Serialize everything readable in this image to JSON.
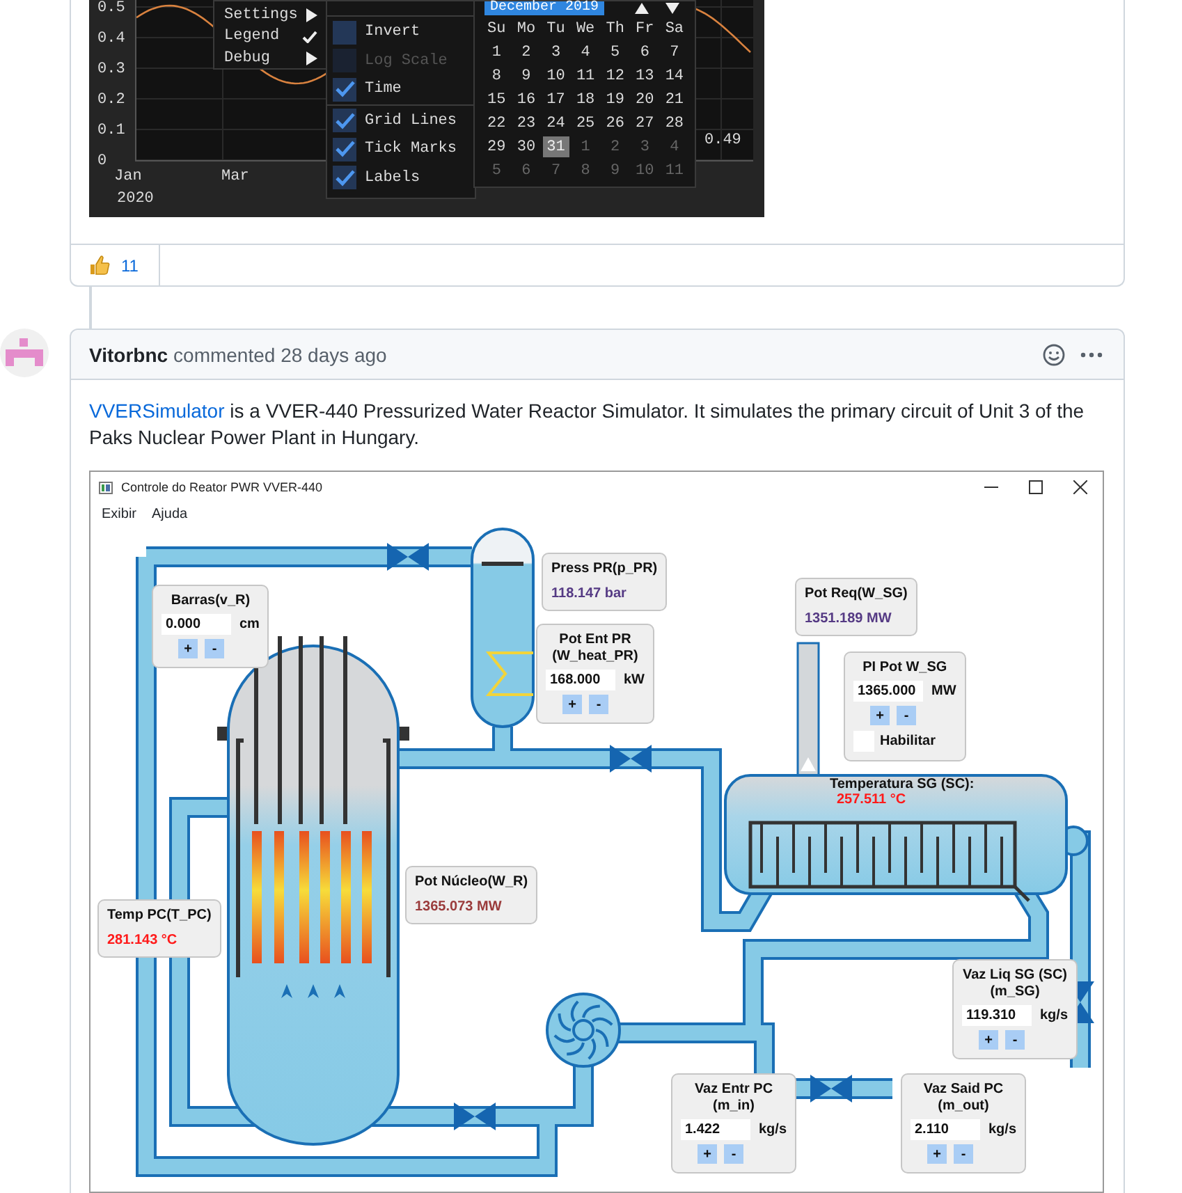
{
  "plot_image": {
    "y_ticks": [
      "0.5",
      "0.4",
      "0.3",
      "0.2",
      "0.1",
      "0"
    ],
    "x_ticks": [
      "Jan",
      "Mar"
    ],
    "x_year": "2020",
    "readout": "0.49",
    "context_menu": [
      {
        "label": "Settings",
        "kind": "submenu"
      },
      {
        "label": "Legend",
        "kind": "toggle",
        "checked": true
      },
      {
        "label": "Debug",
        "kind": "submenu"
      }
    ],
    "options_menu": [
      {
        "label": "Invert",
        "checked": false,
        "disabled": false,
        "separator_before": true
      },
      {
        "label": "Log Scale",
        "checked": false,
        "disabled": true,
        "separator_before": false
      },
      {
        "label": "Time",
        "checked": true,
        "disabled": false,
        "separator_before": false
      },
      {
        "label": "Grid Lines",
        "checked": true,
        "disabled": false,
        "separator_before": true
      },
      {
        "label": "Tick Marks",
        "checked": true,
        "disabled": false,
        "separator_before": false
      },
      {
        "label": "Labels",
        "checked": true,
        "disabled": false,
        "separator_before": false
      }
    ],
    "calendar": {
      "month": "December 2019",
      "weekdays": [
        "Su",
        "Mo",
        "Tu",
        "We",
        "Th",
        "Fr",
        "Sa"
      ],
      "weeks": [
        [
          {
            "day": "1",
            "in_month": true,
            "selected": false
          },
          {
            "day": "2",
            "in_month": true,
            "selected": false
          },
          {
            "day": "3",
            "in_month": true,
            "selected": false
          },
          {
            "day": "4",
            "in_month": true,
            "selected": false
          },
          {
            "day": "5",
            "in_month": true,
            "selected": false
          },
          {
            "day": "6",
            "in_month": true,
            "selected": false
          },
          {
            "day": "7",
            "in_month": true,
            "selected": false
          }
        ],
        [
          {
            "day": "8",
            "in_month": true,
            "selected": false
          },
          {
            "day": "9",
            "in_month": true,
            "selected": false
          },
          {
            "day": "10",
            "in_month": true,
            "selected": false
          },
          {
            "day": "11",
            "in_month": true,
            "selected": false
          },
          {
            "day": "12",
            "in_month": true,
            "selected": false
          },
          {
            "day": "13",
            "in_month": true,
            "selected": false
          },
          {
            "day": "14",
            "in_month": true,
            "selected": false
          }
        ],
        [
          {
            "day": "15",
            "in_month": true,
            "selected": false
          },
          {
            "day": "16",
            "in_month": true,
            "selected": false
          },
          {
            "day": "17",
            "in_month": true,
            "selected": false
          },
          {
            "day": "18",
            "in_month": true,
            "selected": false
          },
          {
            "day": "19",
            "in_month": true,
            "selected": false
          },
          {
            "day": "20",
            "in_month": true,
            "selected": false
          },
          {
            "day": "21",
            "in_month": true,
            "selected": false
          }
        ],
        [
          {
            "day": "22",
            "in_month": true,
            "selected": false
          },
          {
            "day": "23",
            "in_month": true,
            "selected": false
          },
          {
            "day": "24",
            "in_month": true,
            "selected": false
          },
          {
            "day": "25",
            "in_month": true,
            "selected": false
          },
          {
            "day": "26",
            "in_month": true,
            "selected": false
          },
          {
            "day": "27",
            "in_month": true,
            "selected": false
          },
          {
            "day": "28",
            "in_month": true,
            "selected": false
          }
        ],
        [
          {
            "day": "29",
            "in_month": true,
            "selected": false
          },
          {
            "day": "30",
            "in_month": true,
            "selected": false
          },
          {
            "day": "31",
            "in_month": true,
            "selected": true
          },
          {
            "day": "1",
            "in_month": false,
            "selected": false
          },
          {
            "day": "2",
            "in_month": false,
            "selected": false
          },
          {
            "day": "3",
            "in_month": false,
            "selected": false
          },
          {
            "day": "4",
            "in_month": false,
            "selected": false
          }
        ],
        [
          {
            "day": "5",
            "in_month": false,
            "selected": false
          },
          {
            "day": "6",
            "in_month": false,
            "selected": false
          },
          {
            "day": "7",
            "in_month": false,
            "selected": false
          },
          {
            "day": "8",
            "in_month": false,
            "selected": false
          },
          {
            "day": "9",
            "in_month": false,
            "selected": false
          },
          {
            "day": "10",
            "in_month": false,
            "selected": false
          },
          {
            "day": "11",
            "in_month": false,
            "selected": false
          }
        ]
      ]
    }
  },
  "reaction": {
    "count": "11"
  },
  "comment": {
    "author": "Vitorbnc",
    "meta": "commented 28 days ago",
    "link": "VVERSimulator",
    "text": " is a VVER-440 Pressurized Water Reactor Simulator. It simulates the primary circuit of Unit 3 of the Paks Nuclear Power Plant in Hungary."
  },
  "app_window": {
    "title": "Controle do Reator PWR VVER-440",
    "menu": [
      "Exibir",
      "Ajuda"
    ],
    "panels": [
      {
        "kind": "input",
        "title": [
          "Barras(v_R)"
        ],
        "value": "0.000",
        "unit": "cm",
        "buttons": [
          "+",
          "-"
        ]
      },
      {
        "kind": "readout",
        "title": [
          "Press PR(p_PR)"
        ],
        "value": "118.147 bar",
        "color": "#553a84"
      },
      {
        "kind": "input",
        "title": [
          "Pot Ent PR",
          "(W_heat_PR)"
        ],
        "value": "168.000",
        "unit": "kW",
        "buttons": [
          "+",
          "-"
        ]
      },
      {
        "kind": "readout",
        "title": [
          "Pot Req(W_SG)"
        ],
        "value": "1351.189 MW",
        "color": "#553a84"
      },
      {
        "kind": "input",
        "title": [
          "PI Pot W_SG"
        ],
        "value": "1365.000",
        "unit": "MW",
        "buttons": [
          "+",
          "-"
        ],
        "checkbox": {
          "label": "Habilitar",
          "checked": false
        }
      },
      {
        "kind": "label",
        "title": [
          "Temperatura SG (SC):"
        ],
        "value": "257.511 °C",
        "color": "#ff1a1a"
      },
      {
        "kind": "readout",
        "title": [
          "Pot Núcleo(W_R)"
        ],
        "value": "1365.073 MW",
        "color": "#9a3b3b"
      },
      {
        "kind": "readout",
        "title": [
          "Temp PC(T_PC)"
        ],
        "value": "281.143 °C",
        "color": "#ff1a1a"
      },
      {
        "kind": "input",
        "title": [
          "Vaz Liq SG (SC)",
          "(m_SG)"
        ],
        "value": "119.310",
        "unit": "kg/s",
        "buttons": [
          "+",
          "-"
        ]
      },
      {
        "kind": "input",
        "title": [
          "Vaz Entr PC",
          "(m_in)"
        ],
        "value": "1.422",
        "unit": "kg/s",
        "buttons": [
          "+",
          "-"
        ]
      },
      {
        "kind": "input",
        "title": [
          "Vaz Said PC",
          "(m_out)"
        ],
        "value": "2.110",
        "unit": "kg/s",
        "buttons": [
          "+",
          "-"
        ]
      }
    ]
  }
}
